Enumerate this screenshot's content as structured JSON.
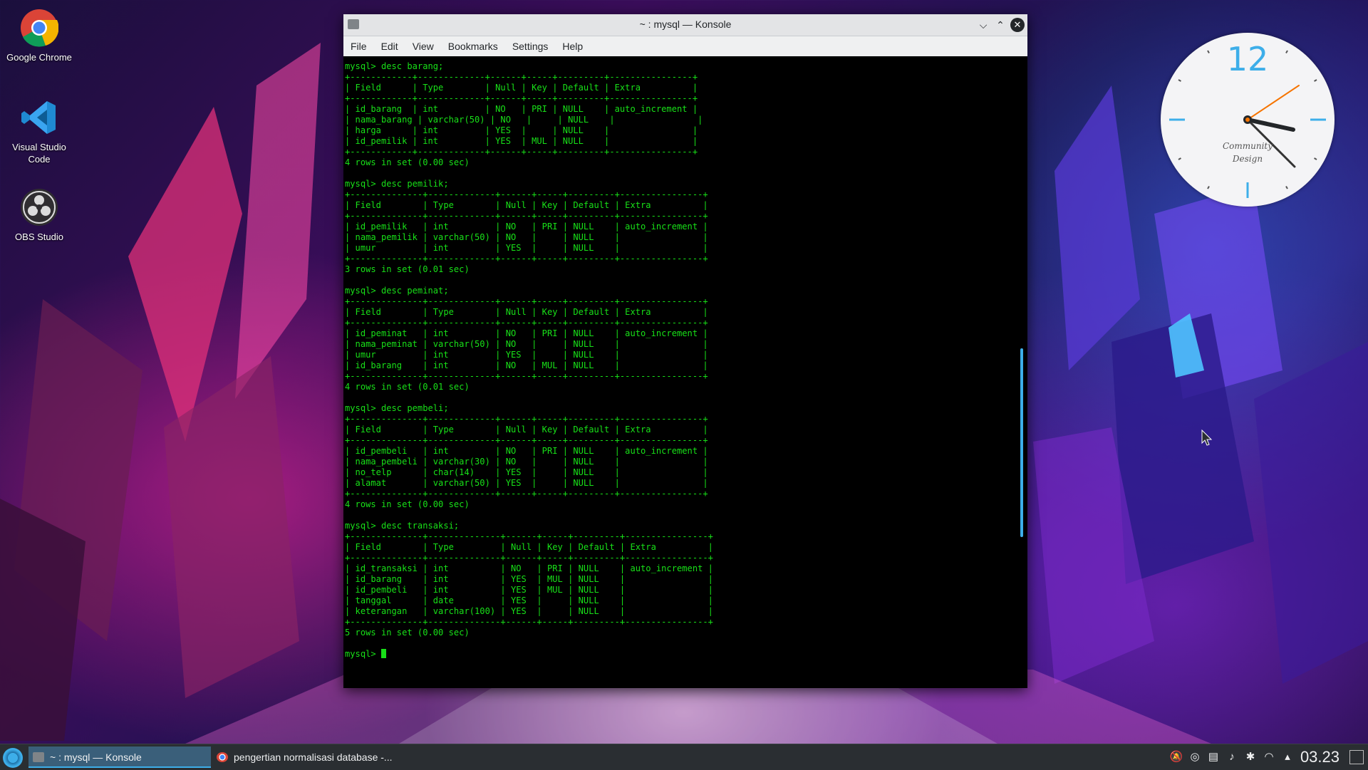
{
  "desktop_icons": [
    {
      "name": "Google Chrome"
    },
    {
      "name": "Visual Studio Code"
    },
    {
      "name": "OBS Studio"
    }
  ],
  "clock_widget": {
    "twelve": "12",
    "brand_line1": "Community",
    "brand_line2": "Design"
  },
  "window": {
    "title": "~ : mysql — Konsole",
    "menu": [
      "File",
      "Edit",
      "View",
      "Bookmarks",
      "Settings",
      "Help"
    ]
  },
  "terminal": {
    "text": "mysql> desc barang;\n+------------+-------------+------+-----+---------+----------------+\n| Field      | Type        | Null | Key | Default | Extra          |\n+------------+-------------+------+-----+---------+----------------+\n| id_barang  | int         | NO   | PRI | NULL    | auto_increment |\n| nama_barang | varchar(50) | NO   |     | NULL    |                |\n| harga      | int         | YES  |     | NULL    |                |\n| id_pemilik | int         | YES  | MUL | NULL    |                |\n+------------+-------------+------+-----+---------+----------------+\n4 rows in set (0.00 sec)\n\nmysql> desc pemilik;\n+--------------+-------------+------+-----+---------+----------------+\n| Field        | Type        | Null | Key | Default | Extra          |\n+--------------+-------------+------+-----+---------+----------------+\n| id_pemilik   | int         | NO   | PRI | NULL    | auto_increment |\n| nama_pemilik | varchar(50) | NO   |     | NULL    |                |\n| umur         | int         | YES  |     | NULL    |                |\n+--------------+-------------+------+-----+---------+----------------+\n3 rows in set (0.01 sec)\n\nmysql> desc peminat;\n+--------------+-------------+------+-----+---------+----------------+\n| Field        | Type        | Null | Key | Default | Extra          |\n+--------------+-------------+------+-----+---------+----------------+\n| id_peminat   | int         | NO   | PRI | NULL    | auto_increment |\n| nama_peminat | varchar(50) | NO   |     | NULL    |                |\n| umur         | int         | YES  |     | NULL    |                |\n| id_barang    | int         | NO   | MUL | NULL    |                |\n+--------------+-------------+------+-----+---------+----------------+\n4 rows in set (0.01 sec)\n\nmysql> desc pembeli;\n+--------------+-------------+------+-----+---------+----------------+\n| Field        | Type        | Null | Key | Default | Extra          |\n+--------------+-------------+------+-----+---------+----------------+\n| id_pembeli   | int         | NO   | PRI | NULL    | auto_increment |\n| nama_pembeli | varchar(30) | NO   |     | NULL    |                |\n| no_telp      | char(14)    | YES  |     | NULL    |                |\n| alamat       | varchar(50) | YES  |     | NULL    |                |\n+--------------+-------------+------+-----+---------+----------------+\n4 rows in set (0.00 sec)\n\nmysql> desc transaksi;\n+--------------+--------------+------+-----+---------+----------------+\n| Field        | Type         | Null | Key | Default | Extra          |\n+--------------+--------------+------+-----+---------+----------------+\n| id_transaksi | int          | NO   | PRI | NULL    | auto_increment |\n| id_barang    | int          | YES  | MUL | NULL    |                |\n| id_pembeli   | int          | YES  | MUL | NULL    |                |\n| tanggal      | date         | YES  |     | NULL    |                |\n| keterangan   | varchar(100) | YES  |     | NULL    |                |\n+--------------+--------------+------+-----+---------+----------------+\n5 rows in set (0.00 sec)\n\n",
    "prompt": "mysql> "
  },
  "taskbar": {
    "tasks": [
      {
        "label": "~ : mysql — Konsole"
      },
      {
        "label": "pengertian normalisasi database -..."
      }
    ],
    "time": "03.23"
  },
  "colors": {
    "accent": "#3daee9",
    "terminal_text": "#18e018",
    "taskbar_bg": "#2a2e32"
  }
}
